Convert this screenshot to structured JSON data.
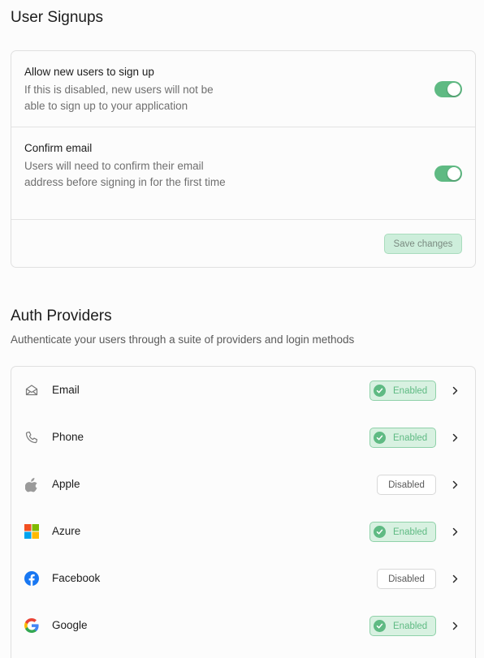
{
  "signups": {
    "heading": "User Signups",
    "allow": {
      "title": "Allow new users to sign up",
      "description": "If this is disabled, new users will not be able to sign up to your application",
      "enabled": true
    },
    "confirm": {
      "title": "Confirm email",
      "description": "Users will need to confirm their email address before signing in for the first time",
      "enabled": true
    },
    "save_label": "Save changes"
  },
  "auth": {
    "heading": "Auth Providers",
    "subtitle": "Authenticate your users through a suite of providers and login methods",
    "providers": [
      {
        "name": "Email",
        "status": "Enabled",
        "icon": "mail-icon"
      },
      {
        "name": "Phone",
        "status": "Enabled",
        "icon": "phone-icon"
      },
      {
        "name": "Apple",
        "status": "Disabled",
        "icon": "apple-icon"
      },
      {
        "name": "Azure",
        "status": "Enabled",
        "icon": "azure-icon"
      },
      {
        "name": "Facebook",
        "status": "Disabled",
        "icon": "facebook-icon"
      },
      {
        "name": "Google",
        "status": "Enabled",
        "icon": "google-icon"
      }
    ]
  },
  "colors": {
    "accent": "#5fba83",
    "accent_light": "#d8f1e1"
  }
}
